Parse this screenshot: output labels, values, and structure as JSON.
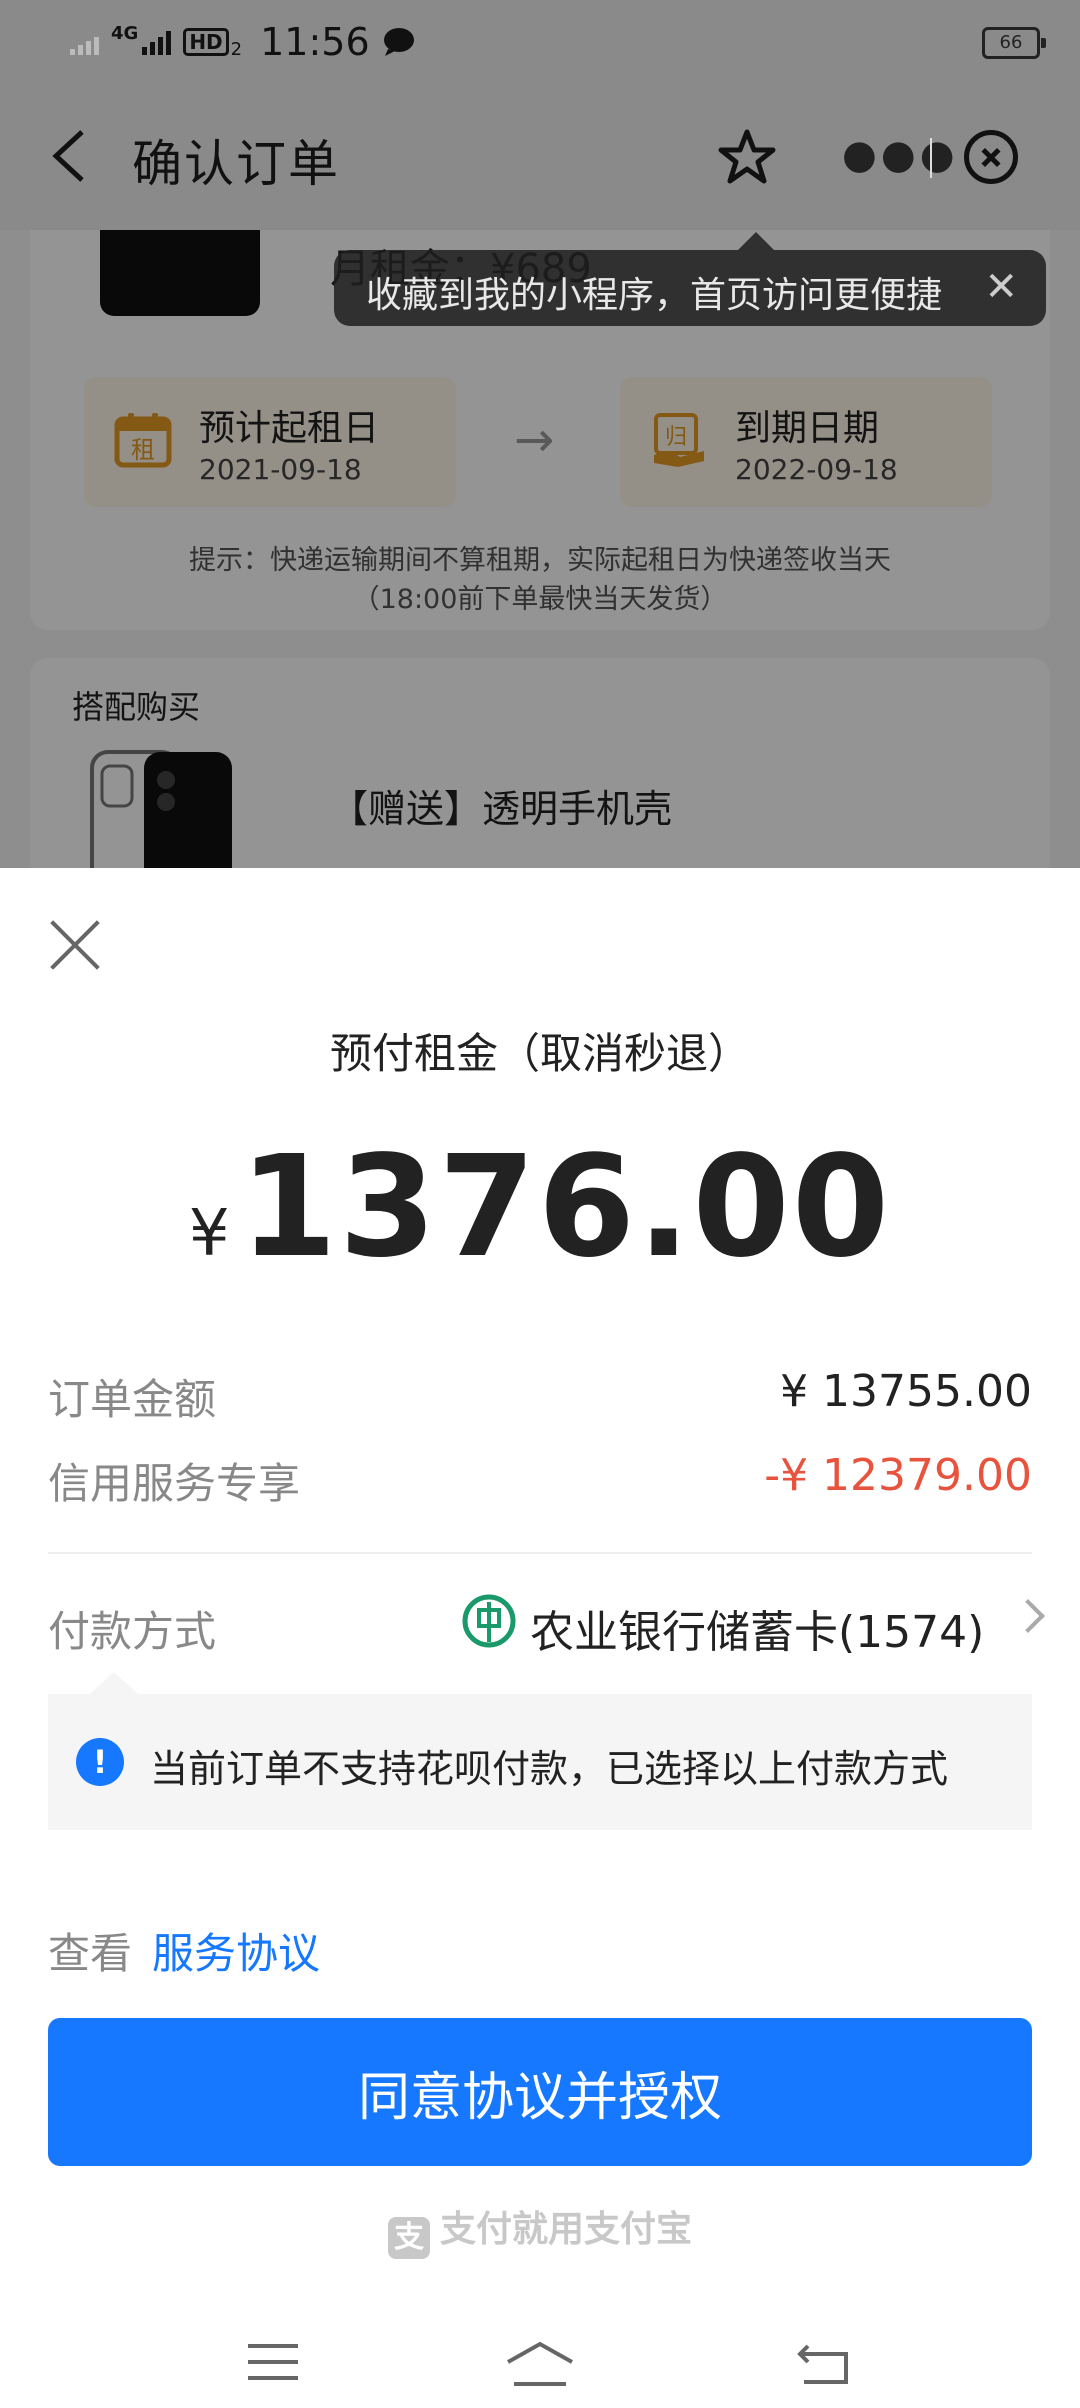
{
  "status_bar": {
    "network": "4G",
    "hd_label": "HD",
    "hd_sub": "2",
    "time": "11:56",
    "battery": "66"
  },
  "nav": {
    "title": "确认订单"
  },
  "tooltip": {
    "text": "收藏到我的小程序，首页访问更便捷",
    "close": "✕"
  },
  "order_card": {
    "monthly_rent": "月租金：¥689",
    "start_label": "预计起租日",
    "start_date": "2021-09-18",
    "start_icon_char": "租",
    "end_label": "到期日期",
    "end_date": "2022-09-18",
    "end_icon_char": "归",
    "arrow": "→",
    "tip_line1": "提示：快递运输期间不算租期，实际起租日为快递签收当天",
    "tip_line2": "（18:00前下单最快当天发货）"
  },
  "addon_card": {
    "title": "搭配购买",
    "item_name": "【赠送】透明手机壳"
  },
  "sheet": {
    "title": "预付租金（取消秒退）",
    "currency": "¥",
    "amount": "1376.00",
    "order_amount_label": "订单金额",
    "order_amount_value": "¥ 13755.00",
    "credit_label": "信用服务专享",
    "credit_value": "-¥ 12379.00",
    "payment_label": "付款方式",
    "payment_method": "农业银行储蓄卡(1574)",
    "notice_icon": "!",
    "notice": "当前订单不支持花呗付款，已选择以上付款方式",
    "agreement_prefix": "查看",
    "agreement_link": "服务协议",
    "cta": "同意协议并授权",
    "footer_logo": "支",
    "footer": "支付就用支付宝"
  },
  "colors": {
    "primary": "#1677ff",
    "discount": "#e8533d",
    "bank_green": "#1a9a6a"
  }
}
